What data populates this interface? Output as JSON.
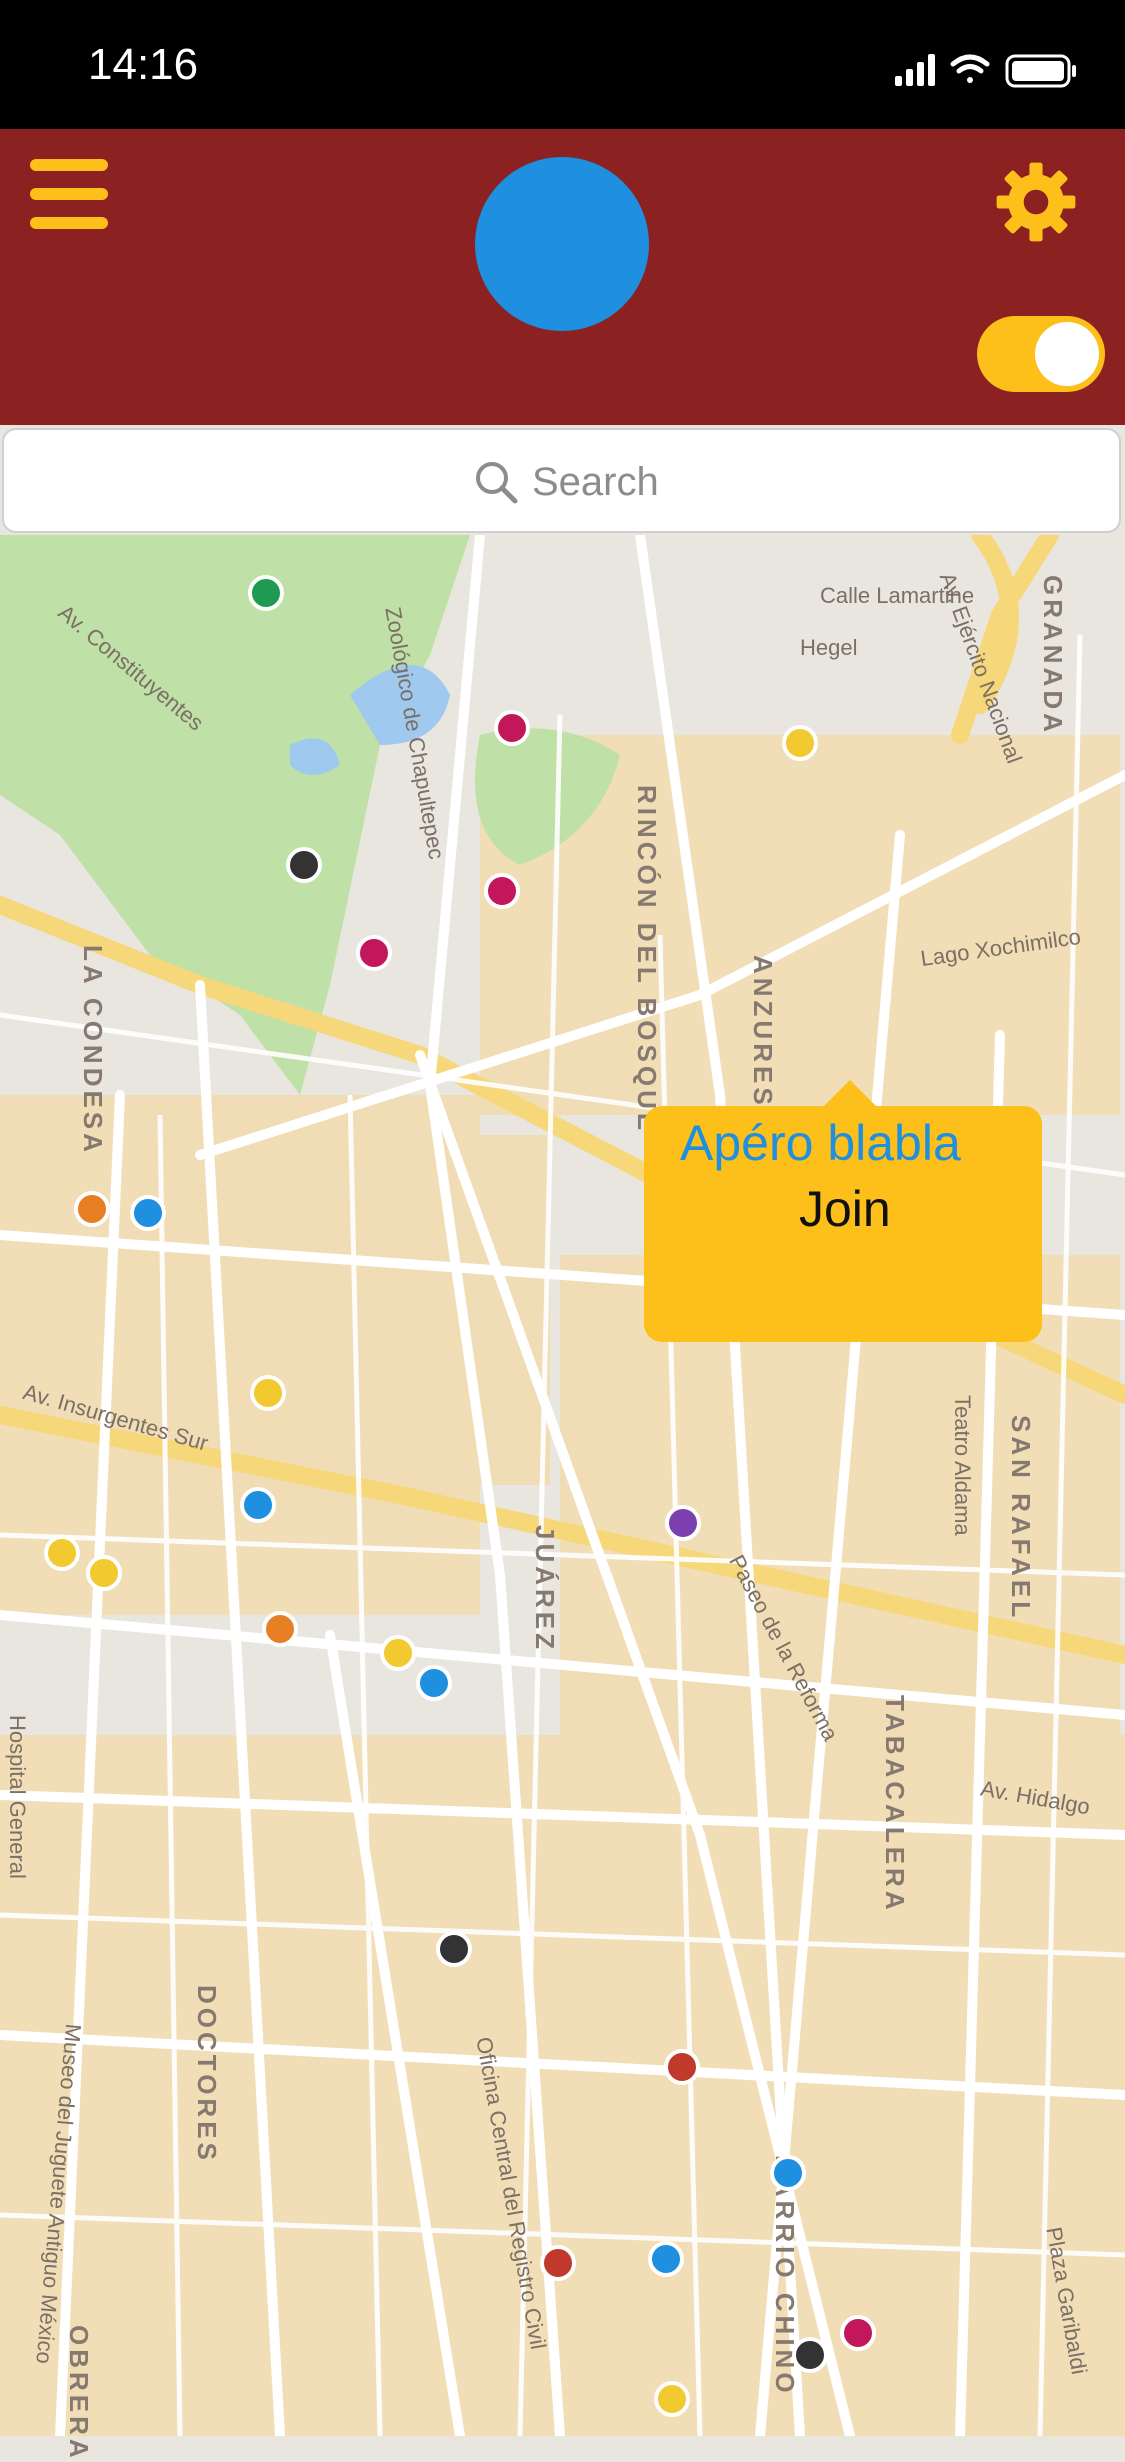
{
  "status_bar": {
    "time": "14:16"
  },
  "header": {
    "toggle_on": true
  },
  "search": {
    "label": "Search"
  },
  "map": {
    "labels": [
      "GRANADA",
      "RINCÓN DEL BOSQUE",
      "ANZURES",
      "LA CONDESA",
      "JUÁREZ",
      "SAN RAFAEL",
      "TABACALERA",
      "DOCTORES",
      "BARRIO CHINO",
      "OBRERA",
      "Av. Insurgentes Sur",
      "Av. Constituyentes",
      "Av. Ejército Nacional",
      "Calle Lamartine",
      "Hegel",
      "Lago Xochimilco",
      "Paseo de la Reforma",
      "Av. Hidalgo",
      "Teatro Aldama",
      "Hospital General",
      "Oficina Central del Registro Civil",
      "Museo del Juguete Antiguo México",
      "Plaza Garibaldi",
      "Zoológico de Chapultepec"
    ]
  },
  "event_popup": {
    "title": "Apéro blabla",
    "join_label": "Join"
  }
}
